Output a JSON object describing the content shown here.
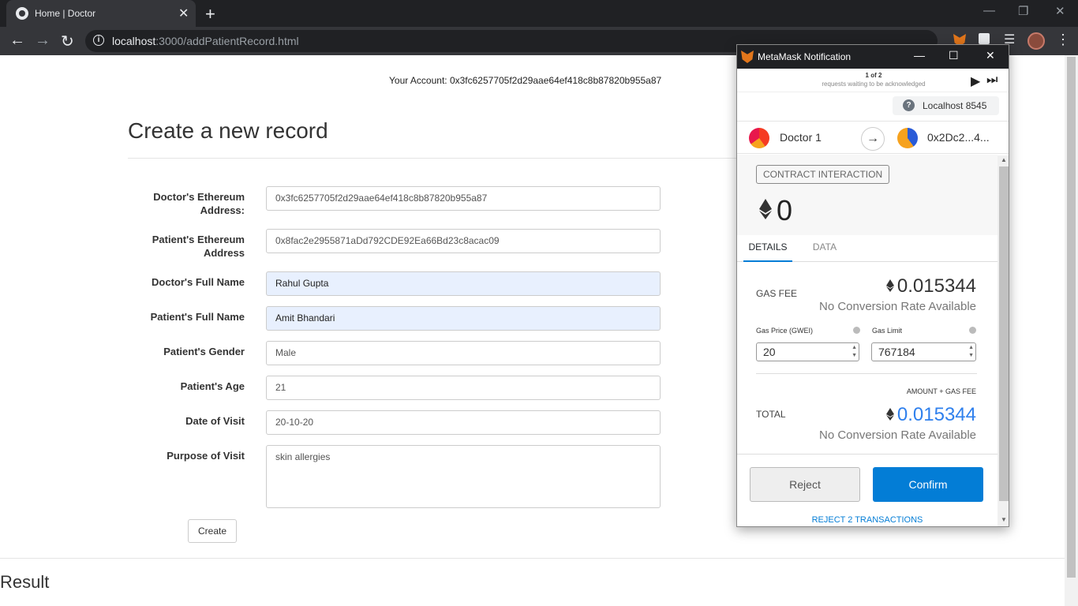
{
  "browser": {
    "tab_title": "Home | Doctor",
    "tab_close": "✕",
    "new_tab": "+",
    "url_host": "localhost",
    "url_rest": ":3000/addPatientRecord.html",
    "win_minimize": "—",
    "win_restore": "❐",
    "win_close": "✕"
  },
  "page": {
    "account_label": "Your Account: 0x3fc6257705f2d29aae64ef418c8b87820b955a87",
    "title": "Create a new record",
    "fields": [
      {
        "label": "Doctor's Ethereum Address:",
        "value": "0x3fc6257705f2d29aae64ef418c8b87820b955a87"
      },
      {
        "label": "Patient's Ethereum Address",
        "value": "0x8fac2e2955871aDd792CDE92Ea66Bd23c8acac09"
      },
      {
        "label": "Doctor's Full Name",
        "value": "Rahul Gupta"
      },
      {
        "label": "Patient's Full Name",
        "value": "Amit Bhandari"
      },
      {
        "label": "Patient's Gender",
        "value": "Male"
      },
      {
        "label": "Patient's Age",
        "value": "21"
      },
      {
        "label": "Date of Visit",
        "value": "20-10-20"
      },
      {
        "label": "Purpose of Visit",
        "value": "skin allergies"
      }
    ],
    "create_button": "Create",
    "result_heading": "Result"
  },
  "metamask": {
    "window_title": "MetaMask Notification",
    "page_count": "1 of 2",
    "waiting_text": "requests waiting to be acknowledged",
    "network": "Localhost 8545",
    "from_account": "Doctor 1",
    "to_account": "0x2Dc2...4...",
    "interaction_badge": "CONTRACT INTERACTION",
    "amount": "0",
    "tabs": [
      "DETAILS",
      "DATA"
    ],
    "gas_fee_label": "GAS FEE",
    "gas_fee_value": "0.015344",
    "no_conversion": "No Conversion Rate Available",
    "gas_price_label": "Gas Price (GWEI)",
    "gas_price_value": "20",
    "gas_limit_label": "Gas Limit",
    "gas_limit_value": "767184",
    "amount_plus_gas_label": "AMOUNT + GAS FEE",
    "total_label": "TOTAL",
    "total_value": "0.015344",
    "reject_button": "Reject",
    "confirm_button": "Confirm",
    "reject_all_link": "REJECT 2 TRANSACTIONS",
    "accent_color": "#037dd6"
  }
}
